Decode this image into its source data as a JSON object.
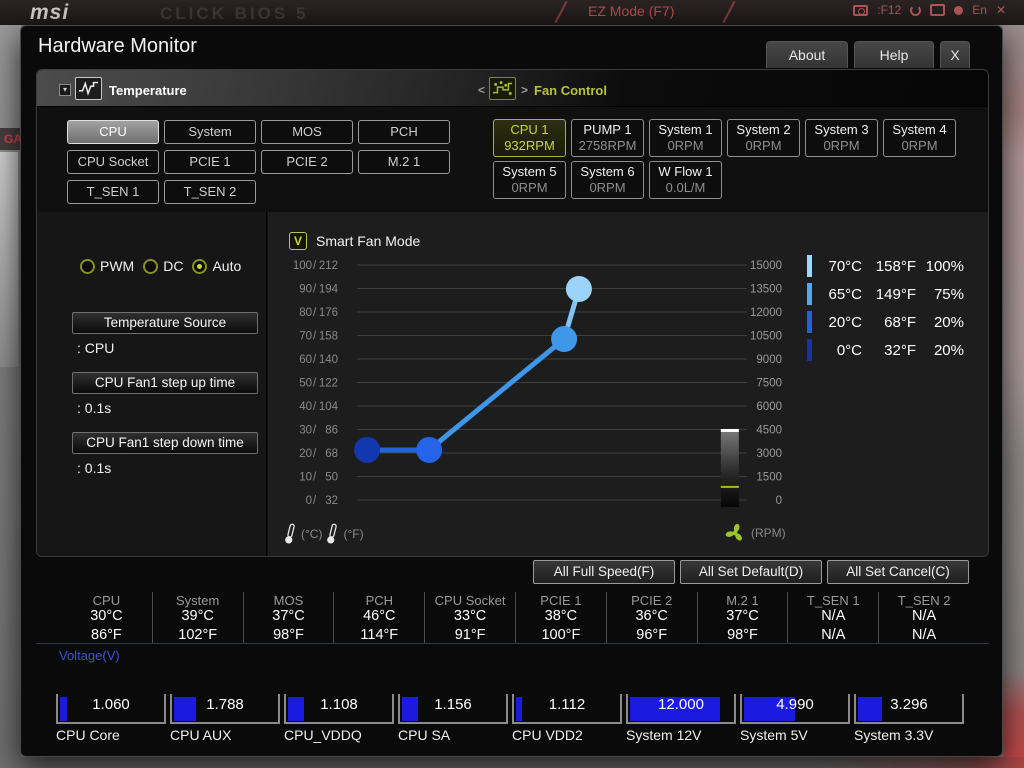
{
  "backdrop": {
    "logo": "msi",
    "bios_text": "CLICK BIOS 5",
    "ez_mode": "EZ Mode (F7)",
    "f12_label": ":F12",
    "lang_label": "En",
    "close_glyph": "✕",
    "ga_label": "GA",
    "red": "#b34c4c"
  },
  "dialog": {
    "title": "Hardware Monitor",
    "about_label": "About",
    "help_label": "Help",
    "close_label": "X"
  },
  "temperature_section": {
    "title": "Temperature",
    "collapse_glyph": "▾",
    "buttons": [
      {
        "label": "CPU",
        "selected": true
      },
      {
        "label": "System",
        "selected": false
      },
      {
        "label": "MOS",
        "selected": false
      },
      {
        "label": "PCH",
        "selected": false
      },
      {
        "label": "CPU Socket",
        "selected": false
      },
      {
        "label": "PCIE 1",
        "selected": false
      },
      {
        "label": "PCIE 2",
        "selected": false
      },
      {
        "label": "M.2 1",
        "selected": false
      },
      {
        "label": "T_SEN 1",
        "selected": false
      },
      {
        "label": "T_SEN 2",
        "selected": false
      }
    ],
    "row_counts": [
      4,
      4,
      2
    ]
  },
  "fan_section": {
    "title": "Fan Control",
    "prev_glyph": "<",
    "next_glyph": ">",
    "fans": [
      {
        "name": "CPU 1",
        "value": "932RPM",
        "selected": true
      },
      {
        "name": "PUMP 1",
        "value": "2758RPM",
        "selected": false
      },
      {
        "name": "System 1",
        "value": "0RPM",
        "selected": false
      },
      {
        "name": "System 2",
        "value": "0RPM",
        "selected": false
      },
      {
        "name": "System 3",
        "value": "0RPM",
        "selected": false
      },
      {
        "name": "System 4",
        "value": "0RPM",
        "selected": false
      },
      {
        "name": "System 5",
        "value": "0RPM",
        "selected": false
      },
      {
        "name": "System 6",
        "value": "0RPM",
        "selected": false
      },
      {
        "name": "W Flow 1",
        "value": "0.0L/M",
        "selected": false
      }
    ],
    "row_counts": [
      6,
      3
    ]
  },
  "controls": {
    "modes": [
      {
        "label": "PWM",
        "selected": false
      },
      {
        "label": "DC",
        "selected": false
      },
      {
        "label": "Auto",
        "selected": true
      }
    ],
    "fields": [
      {
        "label": "Temperature Source",
        "value": ": CPU"
      },
      {
        "label": "CPU Fan1 step up time",
        "value": ": 0.1s"
      },
      {
        "label": "CPU Fan1 step down time",
        "value": ": 0.1s"
      }
    ]
  },
  "chart_data": {
    "type": "line",
    "title": "Smart Fan Mode",
    "checkbox_glyph": "V",
    "checkbox_checked": true,
    "x_axis": {
      "label": "Temperature",
      "min_c": 0,
      "max_c": 100
    },
    "left_axis": {
      "rows": [
        {
          "c": "100",
          "f": "212"
        },
        {
          "c": "90",
          "f": "194"
        },
        {
          "c": "80",
          "f": "176"
        },
        {
          "c": "70",
          "f": "158"
        },
        {
          "c": "60",
          "f": "140"
        },
        {
          "c": "50",
          "f": "122"
        },
        {
          "c": "40",
          "f": "104"
        },
        {
          "c": "30",
          "f": "86"
        },
        {
          "c": "20",
          "f": "68"
        },
        {
          "c": "10",
          "f": "50"
        },
        {
          "c": "0",
          "f": "32"
        }
      ],
      "unit_c": "(°C)",
      "unit_f": "(°F)"
    },
    "right_axis": {
      "labels": [
        "15000",
        "13500",
        "12000",
        "10500",
        "9000",
        "7500",
        "6000",
        "4500",
        "3000",
        "1500",
        "0"
      ],
      "unit": "(RPM)",
      "min": 0,
      "max": 15000
    },
    "points": [
      {
        "temp_c": 0,
        "temp_f": 32,
        "percent": 20,
        "fx": 0.026,
        "fy": 0.787,
        "color": "#1238b0"
      },
      {
        "temp_c": 20,
        "temp_f": 68,
        "percent": 20,
        "fx": 0.185,
        "fy": 0.787,
        "color": "#2563e8"
      },
      {
        "temp_c": 65,
        "temp_f": 149,
        "percent": 75,
        "fx": 0.531,
        "fy": 0.315,
        "color": "#3f97ea"
      },
      {
        "temp_c": 70,
        "temp_f": 158,
        "percent": 100,
        "fx": 0.569,
        "fy": 0.102,
        "color": "#9bd4f8"
      }
    ],
    "segment_colors": [
      "#2263d8",
      "#3f97ea",
      "#7fc4f4"
    ],
    "slider": {
      "fx": 0.956,
      "top_f": 0.702,
      "current_f": 0.94,
      "current_rpm": 932,
      "accent": "#a9b52e"
    },
    "grid_color": "#3f3f3f",
    "breakpoints": [
      {
        "c": "70°C",
        "f": "158°F",
        "pct": "100%",
        "color": "#9fd8f8"
      },
      {
        "c": "65°C",
        "f": "149°F",
        "pct": "75%",
        "color": "#4fa8f0"
      },
      {
        "c": "20°C",
        "f": "68°F",
        "pct": "20%",
        "color": "#2561dd"
      },
      {
        "c": "0°C",
        "f": "32°F",
        "pct": "20%",
        "color": "#1a2fa8"
      }
    ]
  },
  "actions": [
    "All Full Speed(F)",
    "All Set Default(D)",
    "All Set Cancel(C)"
  ],
  "status": {
    "sensors": [
      {
        "name": "CPU",
        "c": "30°C",
        "f": "86°F"
      },
      {
        "name": "System",
        "c": "39°C",
        "f": "102°F"
      },
      {
        "name": "MOS",
        "c": "37°C",
        "f": "98°F"
      },
      {
        "name": "PCH",
        "c": "46°C",
        "f": "114°F"
      },
      {
        "name": "CPU Socket",
        "c": "33°C",
        "f": "91°F"
      },
      {
        "name": "PCIE 1",
        "c": "38°C",
        "f": "100°F"
      },
      {
        "name": "PCIE 2",
        "c": "36°C",
        "f": "96°F"
      },
      {
        "name": "M.2 1",
        "c": "37°C",
        "f": "98°F"
      },
      {
        "name": "T_SEN 1",
        "c": "N/A",
        "f": "N/A"
      },
      {
        "name": "T_SEN 2",
        "c": "N/A",
        "f": "N/A"
      }
    ]
  },
  "voltage": {
    "title": "Voltage(V)",
    "bar_color": "#1a1ae0",
    "rails": [
      {
        "name": "CPU Core",
        "value": "1.060",
        "pct": 7
      },
      {
        "name": "CPU AUX",
        "value": "1.788",
        "pct": 21
      },
      {
        "name": "CPU_VDDQ",
        "value": "1.108",
        "pct": 15
      },
      {
        "name": "CPU SA",
        "value": "1.156",
        "pct": 15
      },
      {
        "name": "CPU VDD2",
        "value": "1.112",
        "pct": 6
      },
      {
        "name": "System 12V",
        "value": "12.000",
        "pct": 85
      },
      {
        "name": "System 5V",
        "value": "4.990",
        "pct": 48
      },
      {
        "name": "System 3.3V",
        "value": "3.296",
        "pct": 23
      }
    ]
  }
}
